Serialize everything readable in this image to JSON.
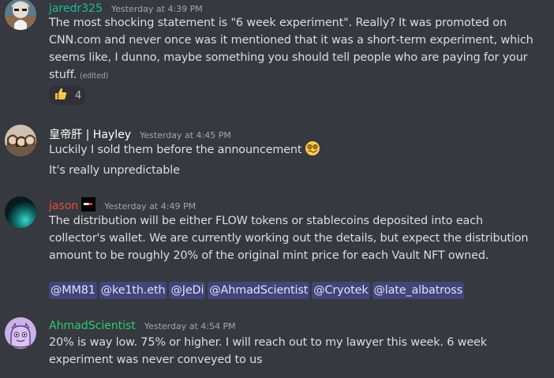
{
  "messages": [
    {
      "author": "jaredr325",
      "author_color": "#1abc9c",
      "timestamp": "Yesterday at 4:39 PM",
      "lines": [
        "The most shocking statement is \"6 week experiment\".  Really?  It was promoted on",
        "CNN.com and never once was it mentioned that it was a short-term experiment, which",
        "seems like, I dunno, maybe something you should tell people who are paying for your",
        "stuff."
      ],
      "edited_label": "(edited)",
      "reaction": {
        "emoji": "thumbs-up-icon",
        "count": "4"
      }
    },
    {
      "author": "皇帝肝 | Hayley",
      "author_color": "#ffffff",
      "timestamp": "Yesterday at 4:45 PM",
      "lines": [
        "Luckily I sold them before the announcement",
        "It's really unpredictable"
      ],
      "inline_emoji": "woozy-face-icon"
    },
    {
      "author": "jason",
      "author_color": "#e74c3c",
      "timestamp": "Yesterday at 4:49 PM",
      "lines": [
        "The distribution will be either FLOW tokens or stablecoins deposited into each",
        "collector's wallet. We are currently working out the details, but expect the distribution",
        "amount to be roughly 20% of the original mint price for each Vault NFT owned."
      ],
      "mentions": [
        "@MM81",
        "@ke1th.eth",
        "@JeDi",
        "@AhmadScientist",
        "@Cryotek",
        "@late_albatross"
      ]
    },
    {
      "author": "AhmadScientist",
      "author_color": "#2ecc71",
      "timestamp": "Yesterday at 4:54 PM",
      "lines": [
        "20% is way low. 75% or higher. I will reach out to my lawyer this week. 6 week",
        "experiment was never conveyed to us"
      ]
    }
  ]
}
